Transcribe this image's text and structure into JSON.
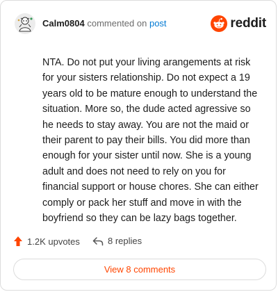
{
  "header": {
    "username": "Calm0804",
    "commented_on": "commented on",
    "post_link": "post",
    "brand_name": "reddit"
  },
  "comment": {
    "text": "NTA. Do not put your living arangements at risk for your sisters relationship. Do not expect a 19 years old to be mature enough to understand the situation. More so, the dude acted agressive so he needs to stay away. You are not the maid or their parent to pay their bills. You did more than enough for your sister until now. She is a young adult and does not need to rely on you for financial support or house chores. She can either comply or pack her stuff and move in with the boyfriend so they can be lazy bags together."
  },
  "actions": {
    "upvotes": "1.2K upvotes",
    "replies": "8 replies"
  },
  "view_comments": "View 8 comments",
  "icons": {
    "avatar": "avatar-icon",
    "brand": "reddit-logo-icon",
    "upvote": "upvote-arrow-icon",
    "reply": "reply-arrow-icon"
  },
  "colors": {
    "accent": "#ff4500",
    "link": "#0079d3",
    "text": "#1c1c1c",
    "muted": "#6b6b6b",
    "border": "#dcdcdc"
  }
}
